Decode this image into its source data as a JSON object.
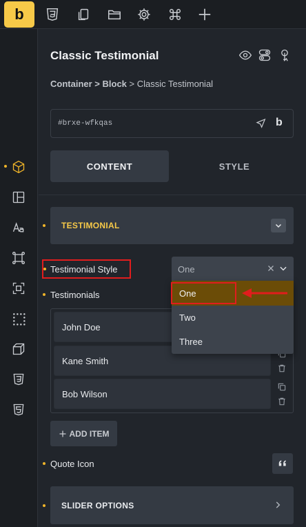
{
  "toolbar": {
    "logo": "b",
    "icons": [
      "css3-icon",
      "copy-icon",
      "folder-icon",
      "gear-icon",
      "command-icon",
      "plus-icon"
    ]
  },
  "panel": {
    "title": "Classic Testimonial",
    "breadcrumb": {
      "part1": "Container",
      "sep1": ">",
      "part2": "Block",
      "sep2": ">",
      "current": "Classic Testimonial"
    },
    "element_id": "#brxe-wfkqas",
    "tabs": {
      "content": "CONTENT",
      "style": "STYLE"
    },
    "section_testimonial": "TESTIMONIAL",
    "testimonial_style_label": "Testimonial Style",
    "testimonial_style_value": "One",
    "dropdown_options": [
      "One",
      "Two",
      "Three"
    ],
    "testimonials_label": "Testimonials",
    "testimonials": [
      "John Doe",
      "Kane Smith",
      "Bob Wilson"
    ],
    "add_item": "ADD ITEM",
    "quote_icon_label": "Quote Icon",
    "section_slider": "SLIDER OPTIONS"
  },
  "colors": {
    "accent": "#f7c948",
    "highlight": "#e11d1d",
    "selected_option_bg": "#6b4c07"
  }
}
